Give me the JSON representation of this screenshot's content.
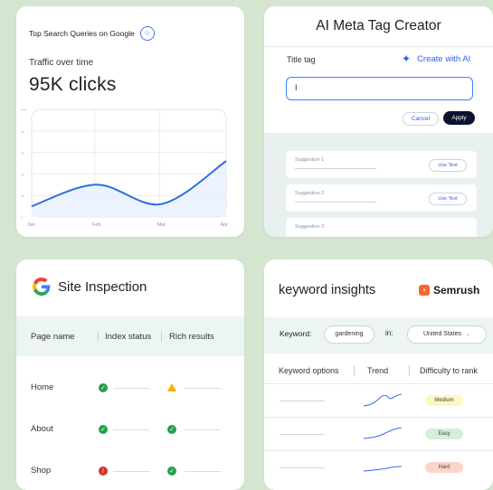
{
  "search_card": {
    "title": "Top Search Queries on Google",
    "subtitle": "Traffic over time",
    "metric": "95K clicks",
    "icon": "star-badge-icon"
  },
  "chart_data": {
    "type": "line",
    "x": [
      "Jan",
      "Feb",
      "Mar",
      "Apr"
    ],
    "xlabel": "",
    "ylabel": "",
    "y_ticks": [
      "10K",
      "8K",
      "6K",
      "4K",
      "2K",
      "0"
    ],
    "ylim": [
      0,
      10
    ],
    "series": [
      {
        "values": [
          1.0,
          3.0,
          1.2,
          5.2
        ]
      }
    ],
    "grid": true,
    "line_color": "#2f6fe0",
    "fill_color": "#e8efff"
  },
  "meta_card": {
    "title": "AI Meta Tag Creator",
    "field_label": "Title tag",
    "ai_button": "Create with AI",
    "input_value": "I",
    "cancel_label": "Cancel",
    "apply_label": "Apply",
    "suggestions": [
      {
        "label": "Suggestion 1",
        "action": "Use Text"
      },
      {
        "label": "Suggestion 2",
        "action": "Use Text"
      },
      {
        "label": "Suggestion 3",
        "action": ""
      }
    ],
    "accent": "#2c63e6"
  },
  "inspection_card": {
    "title": "Site Inspection",
    "columns": [
      "Page name",
      "Index status",
      "Rich results"
    ],
    "rows": [
      {
        "page": "Home",
        "index": "ok",
        "rich": "warning"
      },
      {
        "page": "About",
        "index": "ok",
        "rich": "ok"
      },
      {
        "page": "Shop",
        "index": "error",
        "rich": "ok"
      }
    ],
    "status_colors": {
      "ok": "#22a04b",
      "warning": "#f4b400",
      "error": "#d93025"
    }
  },
  "keyword_card": {
    "title": "keyword insights",
    "brand": "Semrush",
    "keyword_label": "Keyword:",
    "keyword_value": "gardening",
    "in_label": "in:",
    "location_value": "United States",
    "columns": [
      "Keyword options",
      "Trend",
      "Difficulty to rank"
    ],
    "rows": [
      {
        "difficulty": "Medium",
        "color": "#fdf7c4"
      },
      {
        "difficulty": "Easy",
        "color": "#d4f0d9"
      },
      {
        "difficulty": "Hard",
        "color": "#fbd5cc"
      }
    ]
  }
}
